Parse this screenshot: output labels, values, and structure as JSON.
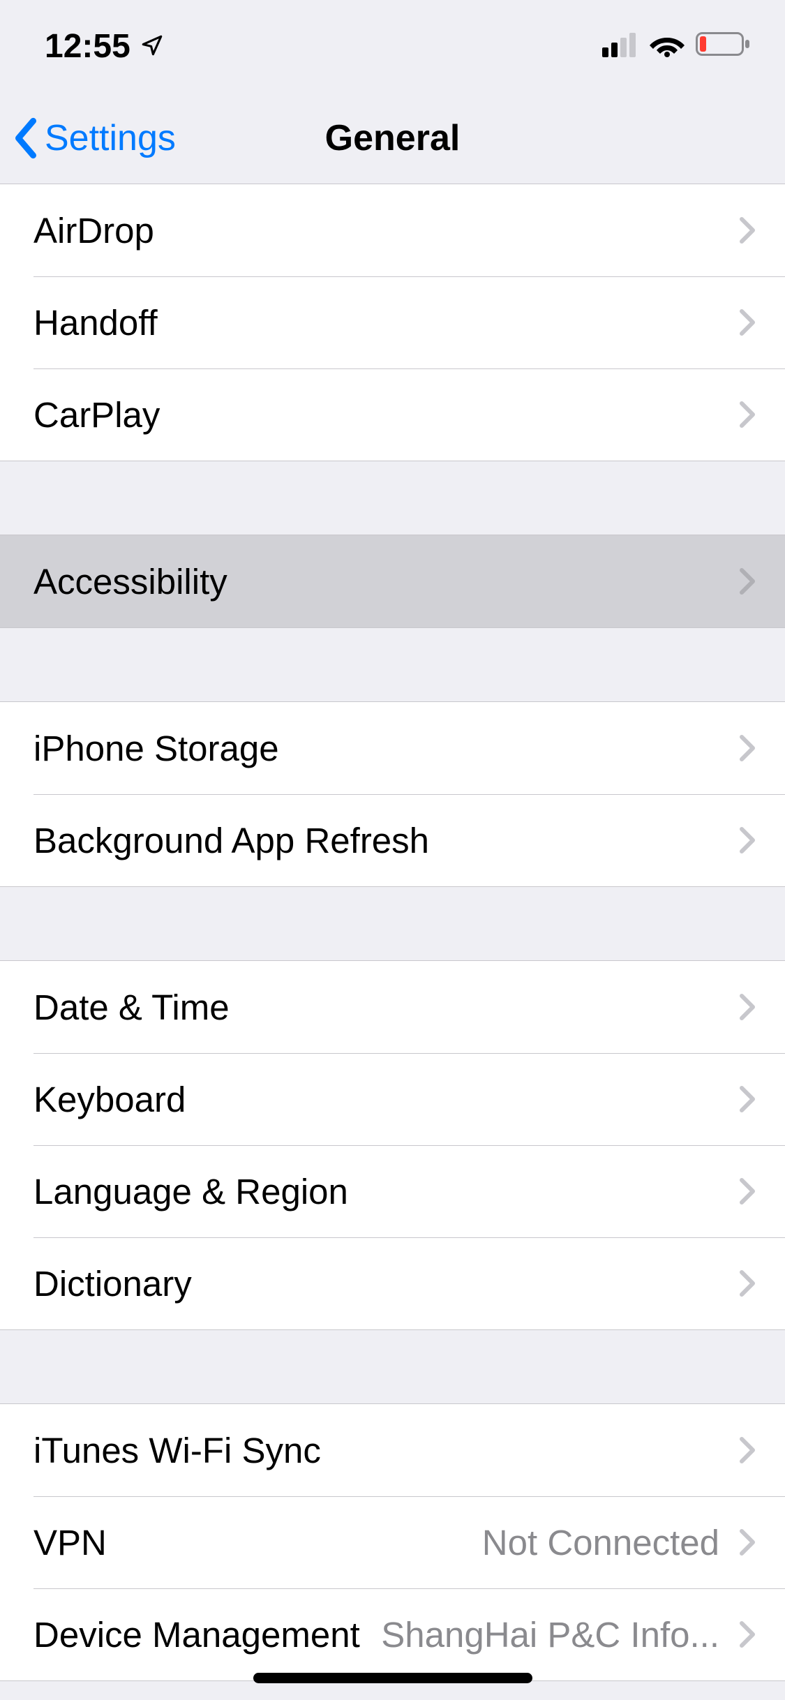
{
  "status_bar": {
    "time": "12:55"
  },
  "nav": {
    "back_label": "Settings",
    "title": "General"
  },
  "groups": [
    {
      "rows": [
        {
          "label": "AirDrop"
        },
        {
          "label": "Handoff"
        },
        {
          "label": "CarPlay"
        }
      ]
    },
    {
      "rows": [
        {
          "label": "Accessibility",
          "selected": true
        }
      ]
    },
    {
      "rows": [
        {
          "label": "iPhone Storage"
        },
        {
          "label": "Background App Refresh"
        }
      ]
    },
    {
      "rows": [
        {
          "label": "Date & Time"
        },
        {
          "label": "Keyboard"
        },
        {
          "label": "Language & Region"
        },
        {
          "label": "Dictionary"
        }
      ]
    },
    {
      "rows": [
        {
          "label": "iTunes Wi-Fi Sync"
        },
        {
          "label": "VPN",
          "detail": "Not Connected"
        },
        {
          "label": "Device Management",
          "detail": "ShangHai P&C Info..."
        }
      ]
    }
  ]
}
